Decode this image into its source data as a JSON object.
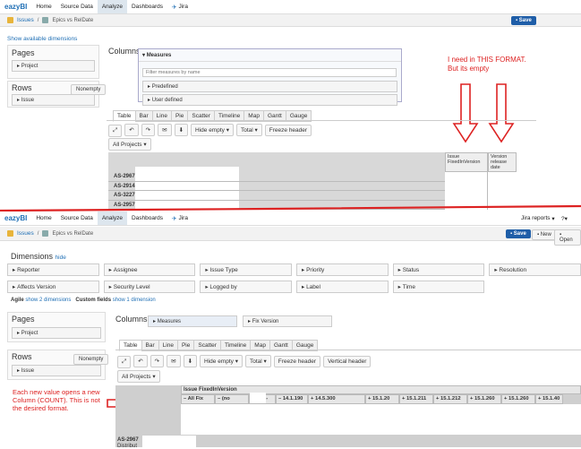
{
  "top": {
    "nav": {
      "logo": "eazyBI",
      "home": "Home",
      "source": "Source Data",
      "analyze": "Analyze",
      "dashboards": "Dashboards",
      "jira": "Jira"
    },
    "breadcrumb": {
      "issues": "Issues",
      "report": "Epics vs RelDate"
    },
    "save": "Save",
    "show_dims": "Show available dimensions",
    "pages_title": "Pages",
    "project": "Project",
    "rows_title": "Rows",
    "nonempty": "Nonempty",
    "issue": "Issue",
    "columns_title": "Columns",
    "measures": "Measures",
    "filter_placeholder": "Filter measures by name",
    "predefined": "Predefined",
    "user_defined": "User defined",
    "tabs": [
      "Table",
      "Bar",
      "Line",
      "Pie",
      "Scatter",
      "Timeline",
      "Map",
      "Gantt",
      "Gauge"
    ],
    "toolbar": {
      "hide_empty": "Hide empty",
      "total": "Total",
      "freeze": "Freeze header"
    },
    "all_projects": "All Projects",
    "col1": "Issue FixedInVersion",
    "col2": "Version release date",
    "rows": [
      "AS-2967",
      "AS-2914",
      "AS-3227",
      "AS-2957"
    ]
  },
  "annotations": {
    "top": "I need in THIS FORMAT.\nBut its empty",
    "bottom": "Each new value opens a new Column (COUNT). This is not the desired format."
  },
  "bottom": {
    "nav": {
      "logo": "eazyBI",
      "home": "Home",
      "source": "Source Data",
      "analyze": "Analyze",
      "dashboards": "Dashboards",
      "jira": "Jira",
      "reports": "Jira reports"
    },
    "breadcrumb": {
      "issues": "Issues",
      "report": "Epics vs RelDate"
    },
    "save": "Save",
    "new": "New",
    "open": "Open",
    "dims_title": "Dimensions",
    "hide": "hide",
    "dims": [
      "Reporter",
      "Assignee",
      "Issue Type",
      "Priority",
      "Status",
      "Resolution",
      "Affects Version",
      "Security Level",
      "Logged by",
      "Label",
      "Time"
    ],
    "agile": "Agile",
    "agile_link": "show 2 dimensions",
    "custom": "Custom fields",
    "custom_link": "show 1 dimension",
    "pages_title": "Pages",
    "project": "Project",
    "rows_title": "Rows",
    "nonempty": "Nonempty",
    "issue": "Issue",
    "columns_title": "Columns",
    "measures": "Measures",
    "fix_version": "Fix Version",
    "tabs": [
      "Table",
      "Bar",
      "Line",
      "Pie",
      "Scatter",
      "Timeline",
      "Map",
      "Gantt",
      "Gauge"
    ],
    "toolbar": {
      "hide_empty": "Hide empty",
      "total": "Total",
      "freeze": "Freeze header",
      "vertical": "Vertical header"
    },
    "all_projects": "All Projects",
    "col_group": "Issue FixedInVersion",
    "col_headers": [
      "– All Fix",
      "– (no",
      "+ 14.1-",
      "– 14.1.190",
      "+ 14.5.300",
      "+ 15.1.20",
      "+ 15.1.211",
      "+ 15.1.212",
      "+ 15.1.260",
      "+ 15.1.260",
      "+ 15.1.40"
    ],
    "row1": "AS-2967",
    "row1b": "Distribut"
  }
}
